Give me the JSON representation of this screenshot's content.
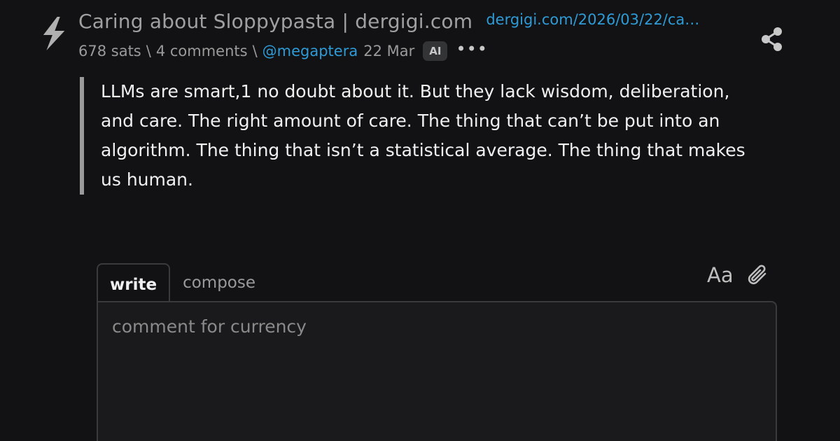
{
  "post": {
    "title": "Caring about Sloppypasta | dergigi.com",
    "link": "dergigi.com/2026/03/22/ca…",
    "sats": "678 sats",
    "sep1": "\\",
    "comments": "4 comments",
    "sep2": "\\",
    "user": "@megaptera",
    "date": "22 Mar",
    "badge": "AI",
    "more": "•••"
  },
  "quote": {
    "text": "LLMs are smart,1 no doubt about it. But they lack wisdom, deliberation, and care. The right amount of care. The thing that can’t be put into an algorithm. The thing that isn’t a statistical average. The thing that makes us human."
  },
  "editor": {
    "tab_write": "write",
    "tab_compose": "compose",
    "format_label": "Aa",
    "placeholder": "comment for currency"
  },
  "icons": {
    "upvote": "bolt-icon",
    "share": "share-icon",
    "attach": "paperclip-icon"
  },
  "colors": {
    "background": "#121214",
    "link": "#2e9bd6",
    "muted": "#9a9a9a",
    "text": "#f0f0f0"
  }
}
